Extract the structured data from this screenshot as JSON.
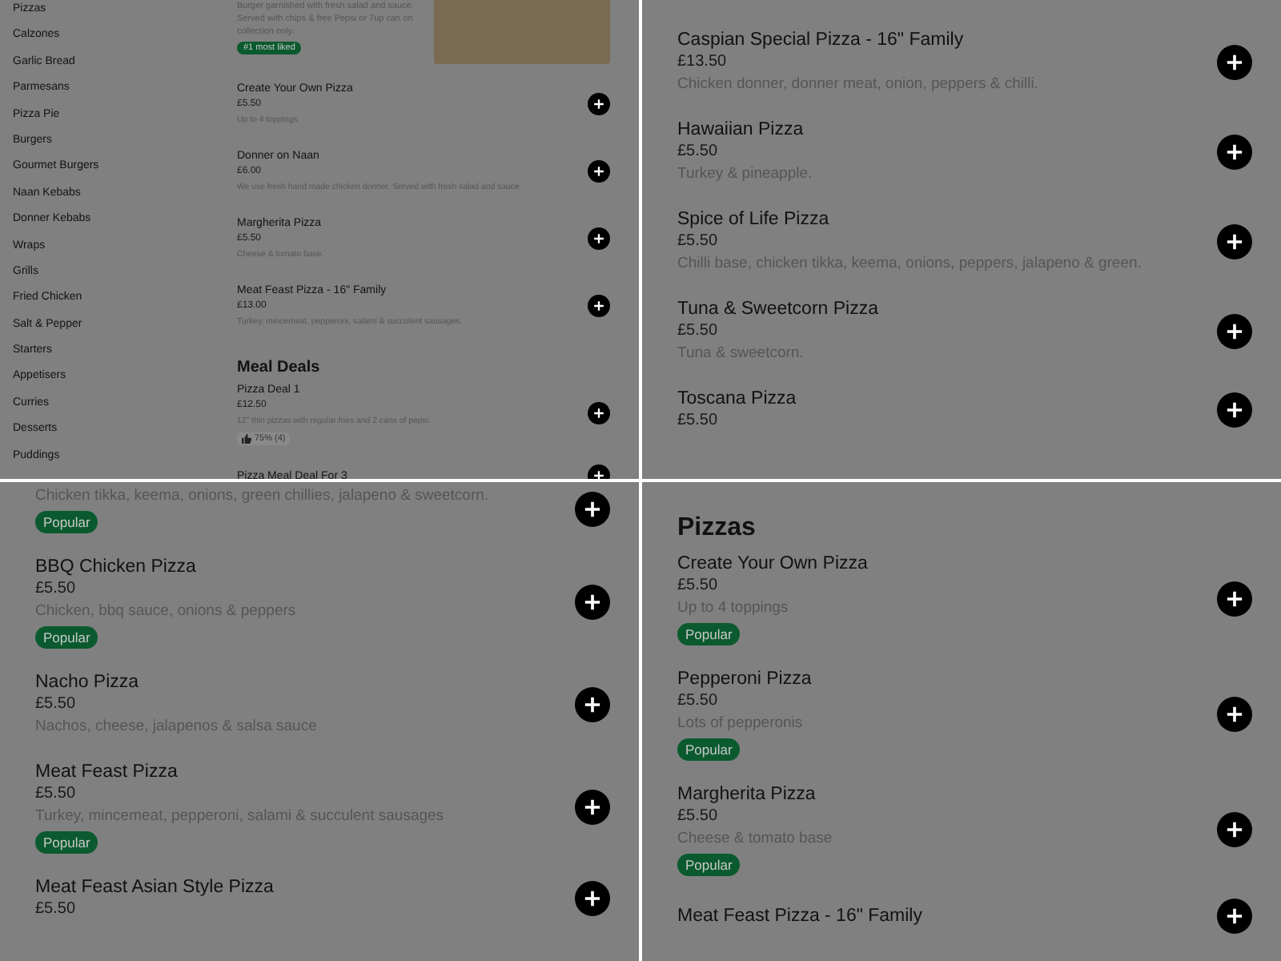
{
  "panels": [
    {
      "kind": "compact",
      "categories": [
        "Pizzas",
        "Calzones",
        "Garlic Bread",
        "Parmesans",
        "Pizza Pie",
        "Burgers",
        "Gourmet Burgers",
        "Naan Kebabs",
        "Donner Kebabs",
        "Wraps",
        "Grills",
        "Fried Chicken",
        "Salt & Pepper",
        "Starters",
        "Appetisers",
        "Curries",
        "Desserts",
        "Puddings"
      ],
      "entries": [
        {
          "kind": "featured",
          "description": "Burger garnished with fresh salad and sauce. Served with chips & free Pepsi or 7up can on collection only.",
          "badge": "#1 most liked"
        },
        {
          "kind": "item",
          "name": "Create Your Own Pizza",
          "price": "£5.50",
          "description": "Up to 4 toppings."
        },
        {
          "kind": "item",
          "name": "Donner on Naan",
          "price": "£6.00",
          "description": "We use fresh hand made chicken donner. Served with fresh salad and sauce."
        },
        {
          "kind": "item",
          "name": "Margherita Pizza",
          "price": "£5.50",
          "description": "Cheese & tomato base."
        },
        {
          "kind": "item",
          "name": "Meat Feast Pizza - 16\" Family",
          "price": "£13.00",
          "description": "Turkey, mincemeat, pepperoni, salami & succulent sausages."
        },
        {
          "kind": "heading",
          "text": "Meal Deals"
        },
        {
          "kind": "item",
          "name": "Pizza Deal 1",
          "price": "£12.50",
          "description": "12\" thin pizzas with regular fries and 2 cans of pepsi.",
          "rating": "75% (4)"
        },
        {
          "kind": "item",
          "name": "Pizza Meal Deal For 3"
        }
      ]
    },
    {
      "kind": "full",
      "entries": [
        {
          "kind": "item",
          "name": "Caspian Special Pizza - 16\" Family",
          "price": "£13.50",
          "description": "Chicken donner, donner meat, onion, peppers & chilli."
        },
        {
          "kind": "item",
          "name": "Hawaiian Pizza",
          "price": "£5.50",
          "description": "Turkey & pineapple."
        },
        {
          "kind": "item",
          "name": "Spice of Life Pizza",
          "price": "£5.50",
          "description": "Chilli base, chicken tikka, keema, onions, peppers, jalapeno & green."
        },
        {
          "kind": "item",
          "name": "Tuna & Sweetcorn Pizza",
          "price": "£5.50",
          "description": "Tuna & sweetcorn."
        },
        {
          "kind": "item",
          "name": "Toscana Pizza",
          "price": "£5.50"
        }
      ]
    },
    {
      "kind": "full",
      "entries": [
        {
          "kind": "item",
          "description": "Chicken tikka, keema, onions, green chillies, jalapeno & sweetcorn.",
          "badge": "Popular"
        },
        {
          "kind": "item",
          "name": "BBQ Chicken Pizza",
          "price": "£5.50",
          "description": "Chicken, bbq sauce, onions & peppers",
          "badge": "Popular"
        },
        {
          "kind": "item",
          "name": "Nacho Pizza",
          "price": "£5.50",
          "description": "Nachos, cheese, jalapenos & salsa sauce"
        },
        {
          "kind": "item",
          "name": "Meat Feast Pizza",
          "price": "£5.50",
          "description": "Turkey, mincemeat, pepperoni, salami & succulent sausages",
          "badge": "Popular"
        },
        {
          "kind": "item",
          "name": "Meat Feast Asian Style Pizza",
          "price": "£5.50"
        }
      ]
    },
    {
      "kind": "full",
      "entries": [
        {
          "kind": "heading",
          "text": "Pizzas"
        },
        {
          "kind": "item",
          "name": "Create Your Own Pizza",
          "price": "£5.50",
          "description": "Up to 4 toppings",
          "badge": "Popular"
        },
        {
          "kind": "item",
          "name": "Pepperoni Pizza",
          "price": "£5.50",
          "description": "Lots of pepperonis",
          "badge": "Popular"
        },
        {
          "kind": "item",
          "name": "Margherita Pizza",
          "price": "£5.50",
          "description": "Cheese & tomato base",
          "badge": "Popular"
        },
        {
          "kind": "item",
          "name": "Meat Feast Pizza - 16\" Family"
        }
      ]
    }
  ]
}
